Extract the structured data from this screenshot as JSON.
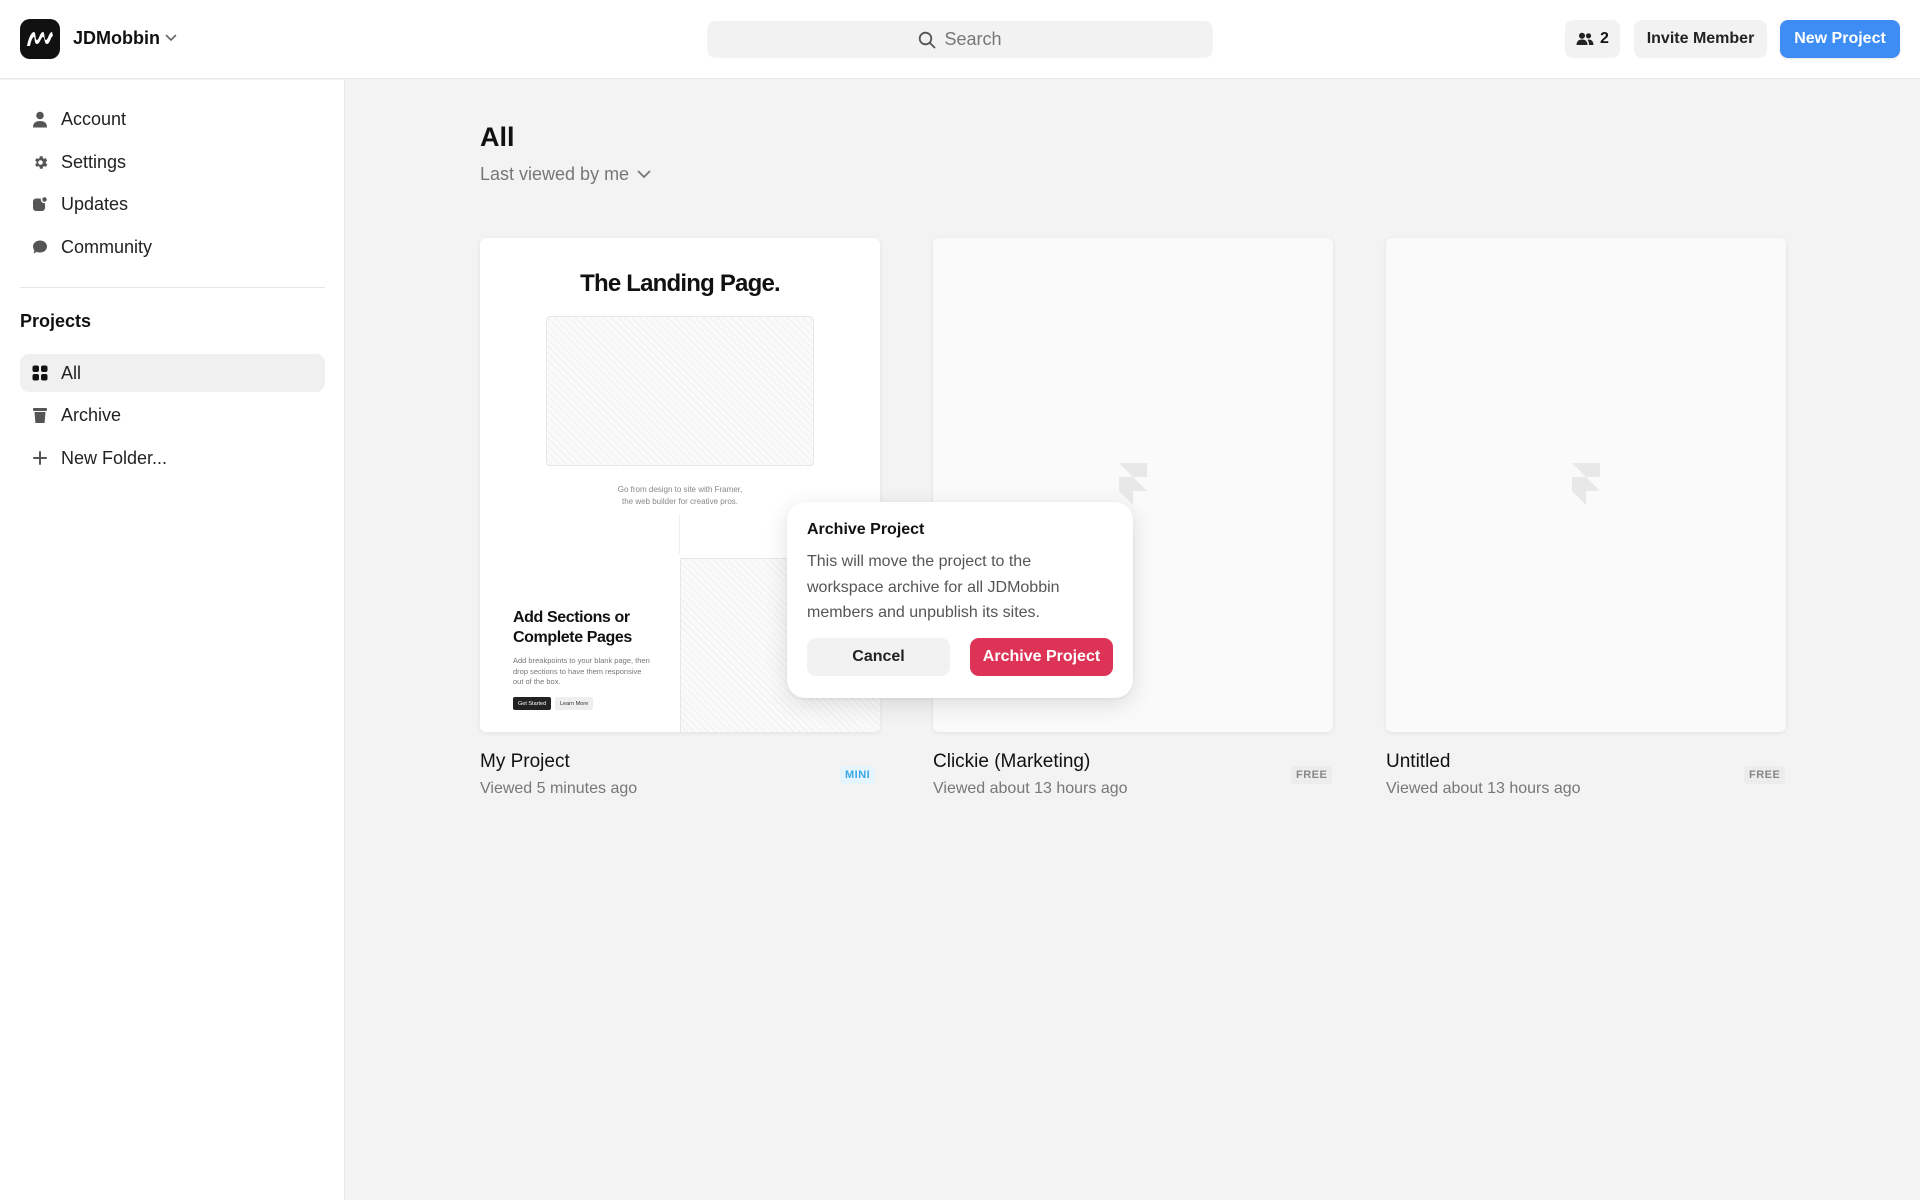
{
  "header": {
    "workspace_name": "JDMobbin",
    "search_placeholder": "Search",
    "member_count": "2",
    "invite_label": "Invite Member",
    "new_project_label": "New Project",
    "accent_color": "#3d8df5"
  },
  "sidebar": {
    "items": [
      {
        "label": "Account",
        "icon": "user-icon"
      },
      {
        "label": "Settings",
        "icon": "gear-icon"
      },
      {
        "label": "Updates",
        "icon": "updates-icon"
      },
      {
        "label": "Community",
        "icon": "chat-bubble-icon"
      }
    ],
    "projects_title": "Projects",
    "project_items": [
      {
        "label": "All",
        "icon": "grid-icon",
        "active": true
      },
      {
        "label": "Archive",
        "icon": "trash-icon"
      },
      {
        "label": "New Folder...",
        "icon": "plus-icon"
      }
    ]
  },
  "main": {
    "title": "All",
    "sort_label": "Last viewed by me",
    "projects": [
      {
        "name": "My Project",
        "meta": "Viewed 5 minutes ago",
        "badge": "MINI",
        "thumbnail": {
          "title": "The Landing Page.",
          "tagline_1": "Go from design to site with Framer,",
          "tagline_2": "the web builder for creative pros.",
          "heading": "Add Sections or Complete Pages",
          "paragraph": "Add breakpoints to your blank page, then drop sections to have them responsive out of the box.",
          "primary_btn": "Get Started",
          "secondary_btn": "Learn More"
        }
      },
      {
        "name": "Clickie (Marketing)",
        "meta": "Viewed about 13 hours ago",
        "badge": "FREE"
      },
      {
        "name": "Untitled",
        "meta": "Viewed about 13 hours ago",
        "badge": "FREE"
      }
    ]
  },
  "archive_popover": {
    "title": "Archive Project",
    "body": "This will move the project to the workspace archive for all JDMobbin members and unpublish its sites.",
    "cancel_label": "Cancel",
    "confirm_label": "Archive Project",
    "danger_color": "#dc3356"
  }
}
